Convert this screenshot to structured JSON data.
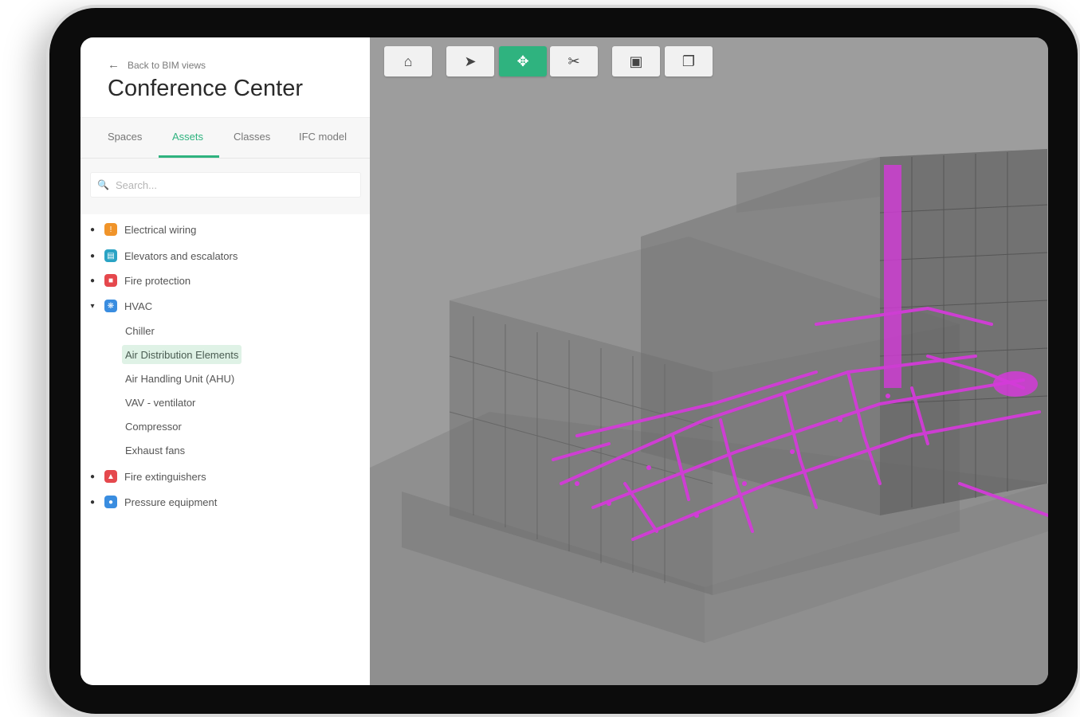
{
  "header": {
    "back_label": "Back to BIM views",
    "title": "Conference Center"
  },
  "tabs": [
    {
      "label": "Spaces"
    },
    {
      "label": "Assets"
    },
    {
      "label": "Classes"
    },
    {
      "label": "IFC model"
    }
  ],
  "search": {
    "placeholder": "Search..."
  },
  "tree": {
    "categories": [
      {
        "label": "Electrical wiring",
        "icon": "warning-icon",
        "color": "#f0942a"
      },
      {
        "label": "Elevators and escalators",
        "icon": "elevator-icon",
        "color": "#2aa3c4"
      },
      {
        "label": "Fire protection",
        "icon": "fire-protection-icon",
        "color": "#e5484d"
      },
      {
        "label": "HVAC",
        "icon": "hvac-icon",
        "color": "#3a8de0"
      },
      {
        "label": "Fire extinguishers",
        "icon": "extinguisher-icon",
        "color": "#e5484d"
      },
      {
        "label": "Pressure equipment",
        "icon": "pressure-icon",
        "color": "#3a8de0"
      }
    ],
    "hvac_children": [
      {
        "label": "Chiller"
      },
      {
        "label": "Air Distribution Elements"
      },
      {
        "label": "Air Handling Unit (AHU)"
      },
      {
        "label": "VAV - ventilator"
      },
      {
        "label": "Compressor"
      },
      {
        "label": "Exhaust fans"
      }
    ]
  },
  "toolbar": {
    "tools": [
      {
        "name": "home-icon"
      },
      {
        "name": "select-icon"
      },
      {
        "name": "pan-icon"
      },
      {
        "name": "section-icon"
      },
      {
        "name": "fit-view-icon"
      },
      {
        "name": "layers-icon"
      }
    ]
  },
  "colors": {
    "accent": "#2fb37f",
    "highlight": "#d33bd8",
    "viewer_bg": "#9b9b9b"
  }
}
